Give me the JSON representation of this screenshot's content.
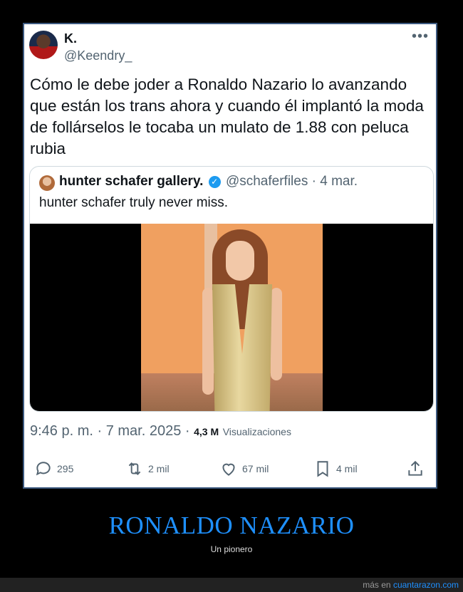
{
  "tweet": {
    "display_name": "K.",
    "handle": "@Keendry_",
    "more_icon": "more-icon",
    "text": "Cómo le debe joder a Ronaldo Nazario lo avanzando que están los trans ahora y cuando él implantó la moda de follárselos le tocaba un mulato de 1.88 con peluca rubia",
    "timestamp": "9:46 p. m. · 7 mar. 2025 ·",
    "views_count": "4,3 M",
    "views_label": "Visualizaciones"
  },
  "quote": {
    "name": "hunter schafer gallery.",
    "handle": "@schaferfiles",
    "date": "· 4 mar.",
    "text": "hunter schafer truly never miss."
  },
  "actions": {
    "replies": "295",
    "retweets": "2 mil",
    "likes": "67 mil",
    "bookmarks": "4 mil"
  },
  "caption": {
    "title": "RONALDO NAZARIO",
    "subtitle": "Un pionero"
  },
  "footer": {
    "prefix": "más en",
    "site": "cuantarazon.com"
  },
  "colors": {
    "accent": "#1e90ff",
    "verified": "#1d9bf0",
    "frame_border": "#3d5a80"
  }
}
